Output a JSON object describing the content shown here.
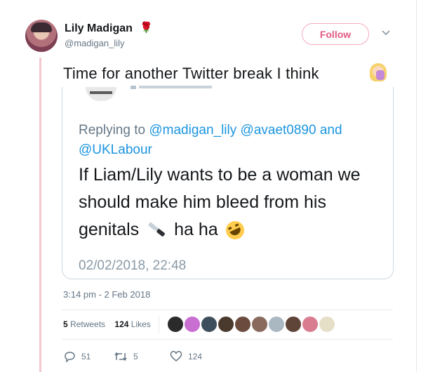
{
  "user": {
    "name": "Lily Madigan",
    "name_emoji": "🌹",
    "handle": "@madigan_lily",
    "follow_label": "Follow"
  },
  "tweet": {
    "text": "Time for another Twitter break I think"
  },
  "quoted": {
    "replying_prefix": "Replying to",
    "mention_1": "@madigan_lily",
    "mention_2": "@avaet0890",
    "mention_joiner": "and",
    "mention_3": "@UKLabour",
    "text_part1": "If Liam/Lily wants to be a woman we should make him bleed from his genitals",
    "text_part2": "ha ha",
    "date": "02/02/2018, 22:48"
  },
  "meta": {
    "timestamp": "3:14 pm - 2 Feb 2018"
  },
  "stats": {
    "retweets_count": "5",
    "retweets_label": "Retweets",
    "likes_count": "124",
    "likes_label": "Likes"
  },
  "actions": {
    "replies": "51",
    "retweets": "5",
    "likes": "124"
  },
  "colors": {
    "brand_pink": "#e25a83",
    "mention_blue": "#1b95e0",
    "thread_line": "#f3c8cf",
    "muted_text": "#657786"
  },
  "icons": [
    "rose-emoji-icon",
    "chevron-down-icon",
    "facepalm-emoji-icon",
    "knife-emoji-icon",
    "rofl-emoji-icon",
    "reply-icon",
    "retweet-icon",
    "heart-icon"
  ]
}
